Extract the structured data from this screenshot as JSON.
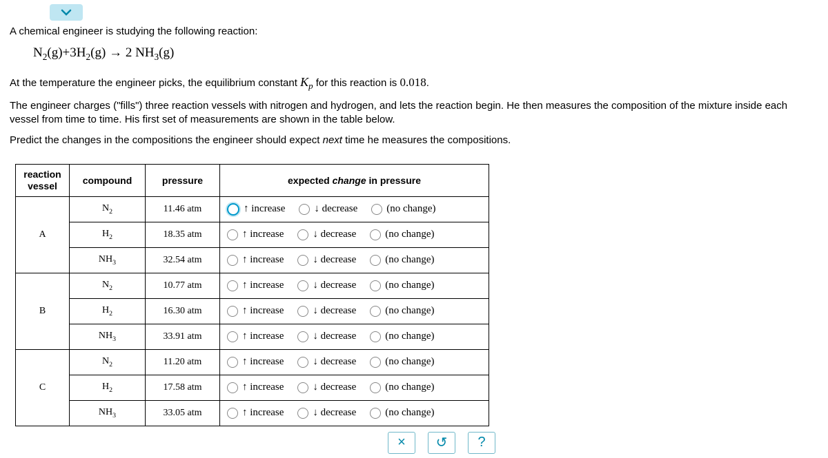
{
  "intro": {
    "line1": "A chemical engineer is studying the following reaction:",
    "line2_pre": "At the temperature the engineer picks, the equilibrium constant ",
    "line2_post": " for this reaction is ",
    "kp_value": "0.018",
    "line2_end": ".",
    "line3": "The engineer charges (\"fills\") three reaction vessels with nitrogen and hydrogen, and lets the reaction begin. He then measures the composition of the mixture inside each vessel from time to time. His first set of measurements are shown in the table below.",
    "line4_pre": "Predict the changes in the compositions the engineer should expect ",
    "line4_ital": "next",
    "line4_post": " time he measures the compositions."
  },
  "equation": {
    "r1": "N",
    "r1sub": "2",
    "r1state": "(g)",
    "plus1": "+",
    "coef2": "3",
    "r2": "H",
    "r2sub": "2",
    "r2state": "(g)",
    "arrow": " → ",
    "coef3": "2 ",
    "p1a": "NH",
    "p1sub": "3",
    "p1state": "(g)"
  },
  "kp_label": {
    "K": "K",
    "p": "p"
  },
  "headers": {
    "vessel": "reaction vessel",
    "compound": "compound",
    "pressure": "pressure",
    "change_pre": "expected ",
    "change_ital": "change",
    "change_post": " in pressure"
  },
  "options": {
    "increase": "↑ increase",
    "decrease": "↓ decrease",
    "nochange": "(no change)"
  },
  "vessels": [
    {
      "id": "A",
      "rows": [
        {
          "compound_base": "N",
          "compound_sub": "2",
          "pressure": "11.46 atm",
          "selected": "increase"
        },
        {
          "compound_base": "H",
          "compound_sub": "2",
          "pressure": "18.35 atm",
          "selected": null
        },
        {
          "compound_base": "NH",
          "compound_sub": "3",
          "pressure": "32.54 atm",
          "selected": null
        }
      ]
    },
    {
      "id": "B",
      "rows": [
        {
          "compound_base": "N",
          "compound_sub": "2",
          "pressure": "10.77 atm",
          "selected": null
        },
        {
          "compound_base": "H",
          "compound_sub": "2",
          "pressure": "16.30 atm",
          "selected": null
        },
        {
          "compound_base": "NH",
          "compound_sub": "3",
          "pressure": "33.91 atm",
          "selected": null
        }
      ]
    },
    {
      "id": "C",
      "rows": [
        {
          "compound_base": "N",
          "compound_sub": "2",
          "pressure": "11.20 atm",
          "selected": null
        },
        {
          "compound_base": "H",
          "compound_sub": "2",
          "pressure": "17.58 atm",
          "selected": null
        },
        {
          "compound_base": "NH",
          "compound_sub": "3",
          "pressure": "33.05 atm",
          "selected": null
        }
      ]
    }
  ],
  "buttons": {
    "clear": "×",
    "reset": "↺",
    "help": "?"
  }
}
